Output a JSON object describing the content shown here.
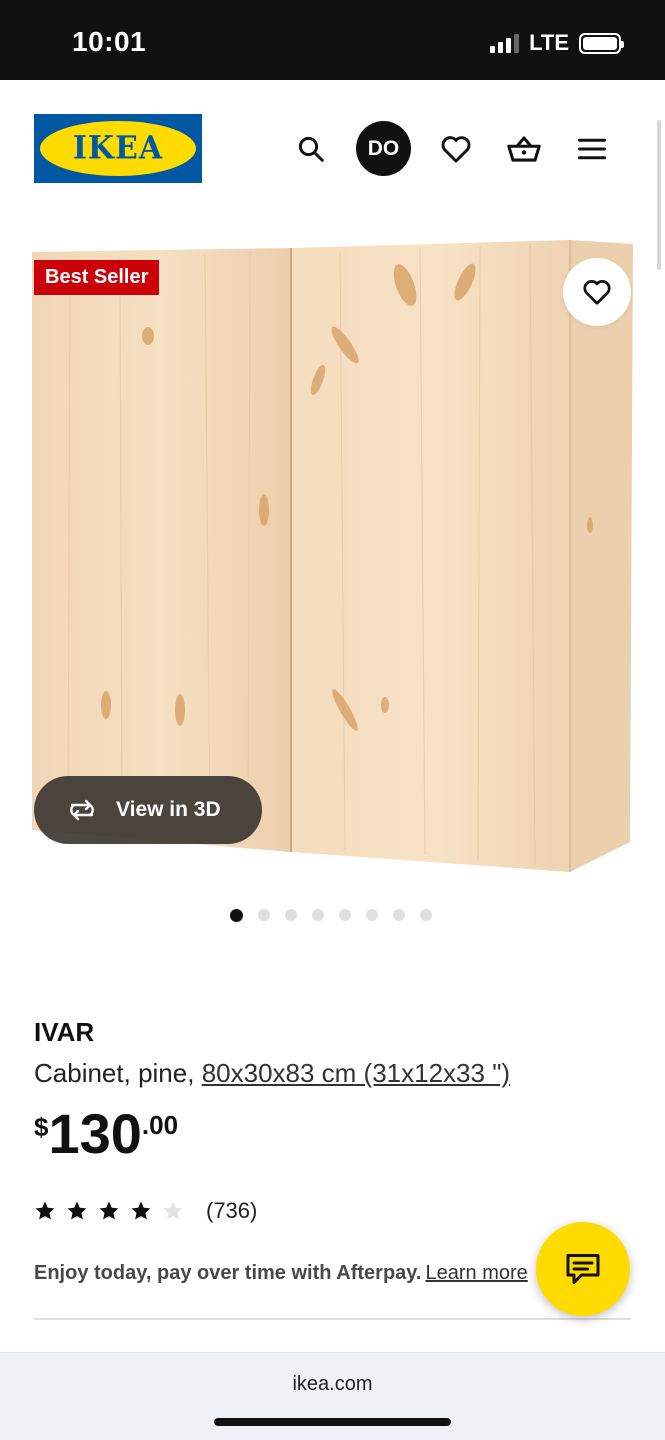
{
  "status_bar": {
    "time": "10:01",
    "network": "LTE"
  },
  "header": {
    "logo_text": "IKEA",
    "avatar_initials": "DO",
    "icons": [
      "search-icon",
      "heart-icon",
      "basket-icon",
      "menu-icon"
    ]
  },
  "product_image": {
    "badge": "Best Seller",
    "view_3d_label": "View in 3D",
    "carousel": {
      "total": 8,
      "active_index": 0
    }
  },
  "product": {
    "name": "IVAR",
    "description_prefix": "Cabinet, pine,",
    "measurements": "80x30x83 cm (31x12x33 \")",
    "price": {
      "currency": "$",
      "integer": "130",
      "decimal": ".00"
    },
    "rating": {
      "stars": 4,
      "max": 5,
      "count": "(736)"
    },
    "afterpay_text": "Enjoy today, pay over time with Afterpay.",
    "afterpay_link": "Learn more"
  },
  "browser": {
    "url": "ikea.com"
  },
  "colors": {
    "brand_blue": "#0058a3",
    "brand_yellow": "#ffdb00",
    "badge_red": "#cc0008"
  }
}
